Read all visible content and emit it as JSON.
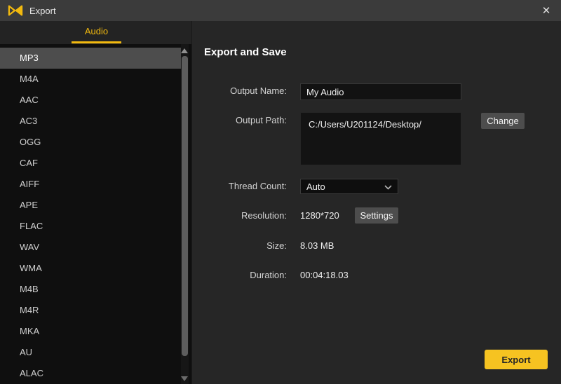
{
  "titlebar": {
    "title": "Export",
    "close_glyph": "✕"
  },
  "sidebar": {
    "tab_label": "Audio",
    "selected_format": "MP3",
    "formats": [
      "MP3",
      "M4A",
      "AAC",
      "AC3",
      "OGG",
      "CAF",
      "AIFF",
      "APE",
      "FLAC",
      "WAV",
      "WMA",
      "M4B",
      "M4R",
      "MKA",
      "AU",
      "ALAC"
    ]
  },
  "panel": {
    "heading": "Export and Save",
    "output_name": {
      "label": "Output Name:",
      "value": "My Audio"
    },
    "output_path": {
      "label": "Output Path:",
      "value": "C:/Users/U201124/Desktop/",
      "change_button": "Change"
    },
    "thread_count": {
      "label": "Thread Count:",
      "value": "Auto"
    },
    "resolution": {
      "label": "Resolution:",
      "value": "1280*720",
      "settings_button": "Settings"
    },
    "size": {
      "label": "Size:",
      "value": "8.03 MB"
    },
    "duration": {
      "label": "Duration:",
      "value": "00:04:18.03"
    },
    "export_button": "Export"
  },
  "colors": {
    "accent_yellow": "#f2b90f",
    "export_button": "#f6c321",
    "selected_row": "#4d4d4d"
  }
}
